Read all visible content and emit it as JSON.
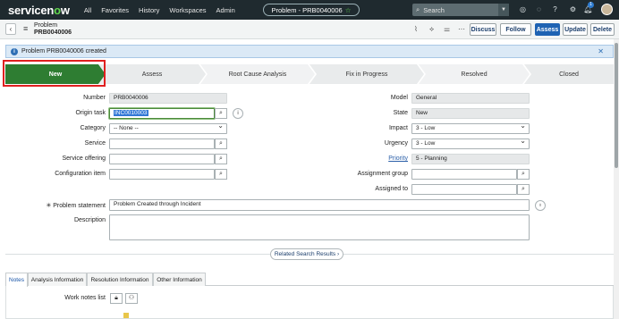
{
  "topnav": {
    "logo_a": "servicen",
    "logo_o": "o",
    "logo_b": "w",
    "items": [
      "All",
      "Favorites",
      "History",
      "Workspaces",
      "Admin"
    ],
    "record_pill": "Problem - PRB0040006",
    "search_placeholder": "Search",
    "notification_count": "1"
  },
  "header": {
    "type": "Problem",
    "number": "PRB0040006",
    "buttons": [
      "Discuss",
      "Follow",
      "Assess",
      "Update",
      "Delete"
    ]
  },
  "message": {
    "text": "Problem PRB0040006 created"
  },
  "stages": [
    "New",
    "Assess",
    "Root Cause Analysis",
    "Fix in Progress",
    "Resolved",
    "Closed"
  ],
  "colors": {
    "nav_bg": "#1f2a2f",
    "stage_active": "#2e7d32",
    "primary_button": "#1f63b3",
    "highlight_box": "#e02020"
  },
  "form": {
    "number_label": "Number",
    "number_value": "PRB0040006",
    "origin_label": "Origin task",
    "origin_value": "INC0010003",
    "category_label": "Category",
    "category_value": "-- None --",
    "service_label": "Service",
    "service_value": "",
    "offering_label": "Service offering",
    "offering_value": "",
    "ci_label": "Configuration item",
    "ci_value": "",
    "model_label": "Model",
    "model_value": "General",
    "state_label": "State",
    "state_value": "New",
    "impact_label": "Impact",
    "impact_value": "3 - Low",
    "urgency_label": "Urgency",
    "urgency_value": "3 - Low",
    "priority_label": "Priority",
    "priority_value": "5 - Planning",
    "group_label": "Assignment group",
    "group_value": "",
    "assigned_label": "Assigned to",
    "assigned_value": "",
    "statement_label": "Problem statement",
    "statement_value": "Problem Created through Incident",
    "description_label": "Description",
    "description_value": ""
  },
  "related_search": "Related Search Results",
  "tabs": [
    "Notes",
    "Analysis Information",
    "Resolution Information",
    "Other Information"
  ],
  "notes": {
    "work_notes_list_label": "Work notes list"
  }
}
